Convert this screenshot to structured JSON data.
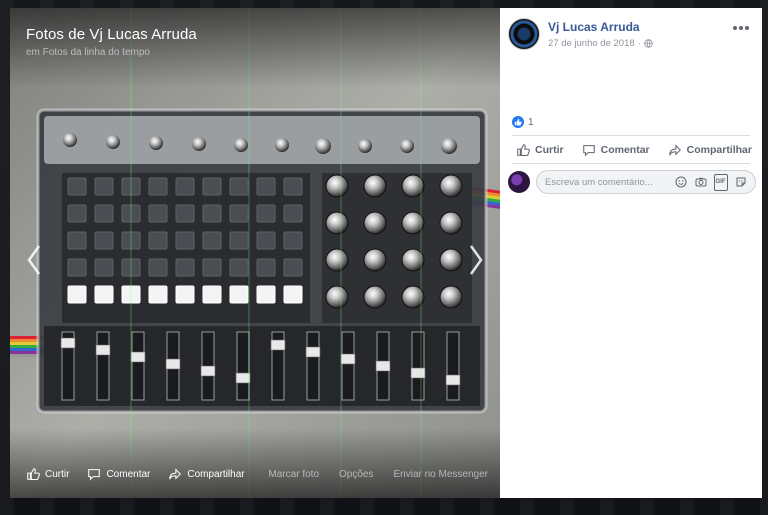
{
  "stage": {
    "album_title": "Fotos de Vj Lucas Arruda",
    "album_subtitle_prefix": "em ",
    "album_link": "Fotos da linha do tempo",
    "nav": {
      "prev_icon": "chevron-left-icon",
      "next_icon": "chevron-right-icon"
    },
    "actions": [
      {
        "label": "Curtir",
        "icon": "like-icon"
      },
      {
        "label": "Comentar",
        "icon": "comment-icon"
      },
      {
        "label": "Compartilhar",
        "icon": "share-icon"
      }
    ],
    "secondary_actions": [
      "Marcar foto",
      "Opções",
      "Enviar no Messenger"
    ]
  },
  "panel": {
    "author": "Vj Lucas Arruda",
    "date": "27 de junho de 2018",
    "separator": "·",
    "privacy_icon": "globe-icon",
    "more_icon": "more-icon",
    "reaction_count": "1",
    "actions": [
      {
        "label": "Curtir",
        "icon": "like-icon"
      },
      {
        "label": "Comentar",
        "icon": "comment-icon"
      },
      {
        "label": "Compartilhar",
        "icon": "share-icon"
      }
    ],
    "comment_placeholder": "Escreva um comentário...",
    "comment_icons": [
      "emoji-icon",
      "camera-icon",
      "gif-icon",
      "sticker-icon"
    ],
    "gif_label": "GIF"
  },
  "colors": {
    "link_blue": "#385898",
    "like_blue": "#2078f4",
    "muted": "#606770"
  }
}
